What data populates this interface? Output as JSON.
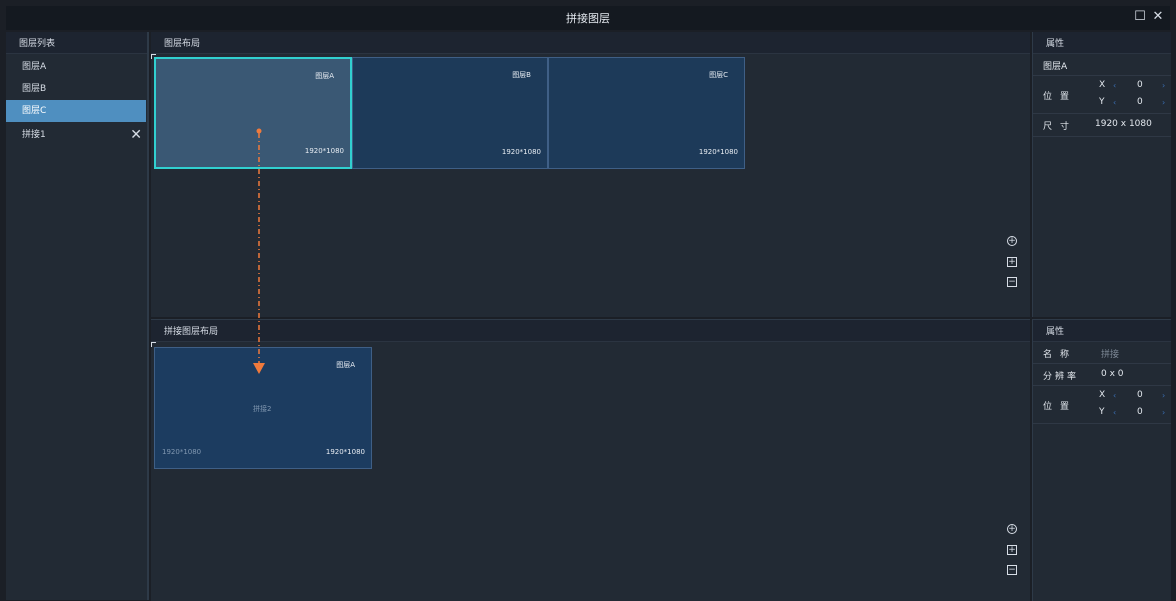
{
  "window": {
    "title": "拼接图层"
  },
  "layer_list": {
    "header": "图层列表",
    "items": [
      {
        "label": "图层A"
      },
      {
        "label": "图层B"
      },
      {
        "label": "图层C"
      },
      {
        "label": "拼接1"
      }
    ]
  },
  "layout": {
    "header": "图层布局",
    "tiles": [
      {
        "name": "图层A",
        "res": "1920*1080"
      },
      {
        "name": "图层B",
        "res": "1920*1080"
      },
      {
        "name": "图层C",
        "res": "1920*1080"
      }
    ]
  },
  "splice_layout": {
    "header": "拼接图层布局",
    "tile": {
      "name": "图层A",
      "center": "拼接2",
      "res_left": "1920*1080",
      "res_right": "1920*1080"
    }
  },
  "props_top": {
    "header": "属性",
    "layer_name": "图层A",
    "position_label": "位置",
    "x_label": "X",
    "x_value": "0",
    "y_label": "Y",
    "y_value": "0",
    "size_label": "尺寸",
    "size_value": "1920 x 1080"
  },
  "props_bottom": {
    "header": "属性",
    "name_label": "名称",
    "name_value": "拼接",
    "resolution_label": "分辨率",
    "resolution_value": "0 x 0",
    "position_label": "位置",
    "x_label": "X",
    "x_value": "0",
    "y_label": "Y",
    "y_value": "0"
  },
  "colors": {
    "accent": "#4f8fc0",
    "selection": "#31d0d0",
    "drag_arrow": "#f07a3c"
  }
}
